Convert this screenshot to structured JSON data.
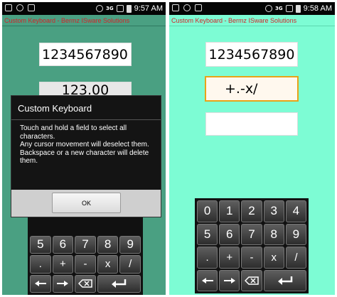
{
  "left_screen": {
    "status": {
      "network": "3G",
      "time": "9:57 AM"
    },
    "title": "Custom Keyboard - Bermz ISware Solutions",
    "fields": [
      {
        "value": "1234567890"
      },
      {
        "value": "123.00"
      }
    ],
    "keyboard": {
      "rows": [
        [
          "5",
          "6",
          "7",
          "8",
          "9"
        ],
        [
          ".",
          "+",
          "-",
          "x",
          "/"
        ]
      ]
    },
    "dialog": {
      "title": "Custom Keyboard",
      "body": [
        "Touch and hold a field to select all characters.",
        "Any cursor movement will deselect them.",
        "Backspace or a new character will delete them."
      ],
      "ok_label": "OK"
    }
  },
  "right_screen": {
    "status": {
      "network": "3G",
      "time": "9:58 AM"
    },
    "title": "Custom Keyboard - Bermz ISware Solutions",
    "fields": [
      {
        "value": "1234567890"
      },
      {
        "value": "+.-x/"
      },
      {
        "value": ""
      }
    ],
    "keyboard": {
      "rows": [
        [
          "0",
          "1",
          "2",
          "3",
          "4"
        ],
        [
          "5",
          "6",
          "7",
          "8",
          "9"
        ],
        [
          ".",
          "+",
          "-",
          "x",
          "/"
        ]
      ]
    }
  }
}
